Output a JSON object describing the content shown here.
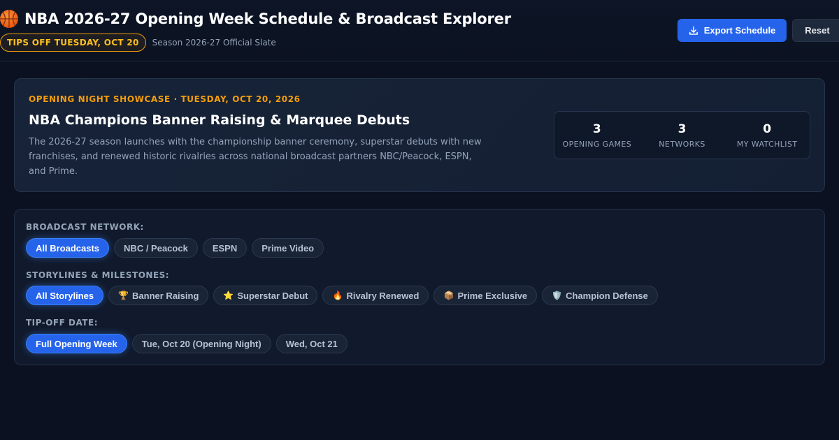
{
  "header": {
    "title": "NBA 2026-27 Opening Week Schedule & Broadcast Explorer",
    "logo_icon": "basketball-icon",
    "tip_badge": "TIPS OFF TUESDAY, OCT 20",
    "season_label": "Season 2026-27 Official Slate",
    "export_label": "Export Schedule",
    "reset_label": "Reset"
  },
  "hero": {
    "eyebrow": "OPENING NIGHT SHOWCASE · TUESDAY, OCT 20, 2026",
    "title": "NBA Champions Banner Raising & Marquee Debuts",
    "description": "The 2026-27 season launches with the championship banner ceremony, superstar debuts with new franchises, and renewed historic rivalries across national broadcast partners NBC/Peacock, ESPN, and Prime.",
    "stats": [
      {
        "value": "3",
        "label": "OPENING GAMES"
      },
      {
        "value": "3",
        "label": "NETWORKS"
      },
      {
        "value": "0",
        "label": "MY WATCHLIST"
      }
    ]
  },
  "filters": {
    "network": {
      "label": "BROADCAST NETWORK:",
      "options": [
        "All Broadcasts",
        "NBC / Peacock",
        "ESPN",
        "Prime Video"
      ],
      "selected": "All Broadcasts"
    },
    "storylines": {
      "label": "STORYLINES & MILESTONES:",
      "options": [
        {
          "icon": "",
          "label": "All Storylines"
        },
        {
          "icon": "🏆",
          "label": "Banner Raising"
        },
        {
          "icon": "⭐",
          "label": "Superstar Debut"
        },
        {
          "icon": "🔥",
          "label": "Rivalry Renewed"
        },
        {
          "icon": "📦",
          "label": "Prime Exclusive"
        },
        {
          "icon": "🛡️",
          "label": "Champion Defense"
        }
      ],
      "selected": "All Storylines"
    },
    "date": {
      "label": "TIP-OFF DATE:",
      "options": [
        "Full Opening Week",
        "Tue, Oct 20 (Opening Night)",
        "Wed, Oct 21"
      ],
      "selected": "Full Opening Week"
    }
  },
  "colors": {
    "background": "#0b1120",
    "accent": "#2563eb",
    "highlight": "#f59e0b"
  }
}
